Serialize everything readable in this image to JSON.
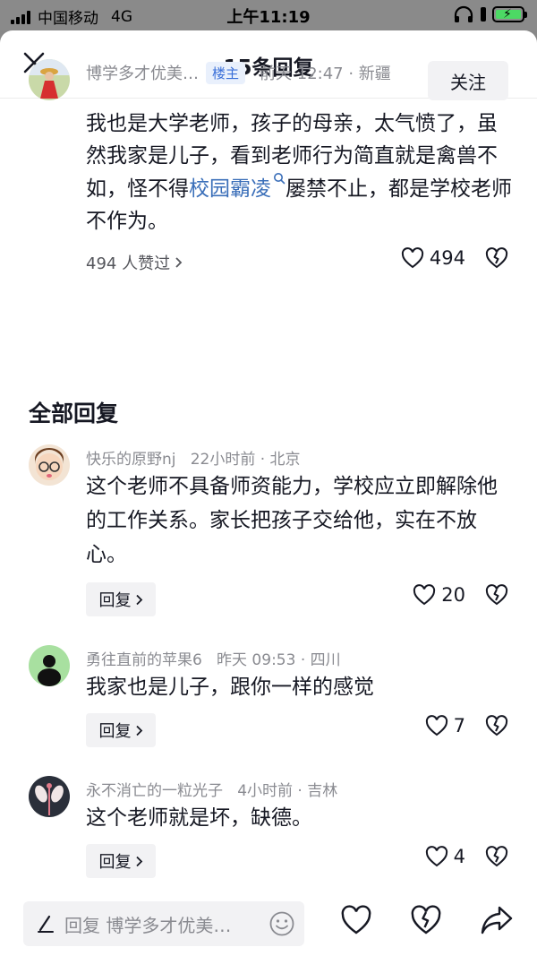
{
  "status_bar": {
    "carrier": "中国移动",
    "network": "4G",
    "time": "上午11:19"
  },
  "header": {
    "title": "15条回复"
  },
  "main_comment": {
    "username": "博学多才优美…",
    "badge": "楼主",
    "time_location": "前天 12:47 · 新疆",
    "follow_label": "关注",
    "text_before": "我也是大学老师，孩子的母亲，太气愤了，虽然我家是儿子，看到老师行为简直就是禽兽不如，怪不得",
    "link_text": "校园霸凌",
    "text_after": "屡禁不止，都是学校老师不作为。",
    "likers": "494 人赞过",
    "like_count": "494"
  },
  "section_title": "全部回复",
  "replies": [
    {
      "meta": "快乐的原野nj   22小时前 · 北京",
      "text": "这个老师不具备师资能力，学校应立即解除他的工作关系。家长把孩子交给他，实在不放心。",
      "reply_label": "回复",
      "like_count": "20"
    },
    {
      "meta": "勇往直前的苹果6   昨天 09:53 · 四川",
      "text": "我家也是儿子，跟你一样的感觉",
      "reply_label": "回复",
      "like_count": "7"
    },
    {
      "meta": "永不消亡的一粒光子   4小时前 · 吉林",
      "text": "这个老师就是坏，缺德。",
      "reply_label": "回复",
      "like_count": "4"
    }
  ],
  "bottom_bar": {
    "placeholder": "回复 博学多才优美…"
  },
  "colors": {
    "link": "#3b6fb9",
    "badge_bg": "#e9f0fc",
    "badge_text": "#3a6fd8",
    "battery": "#4cd964"
  }
}
